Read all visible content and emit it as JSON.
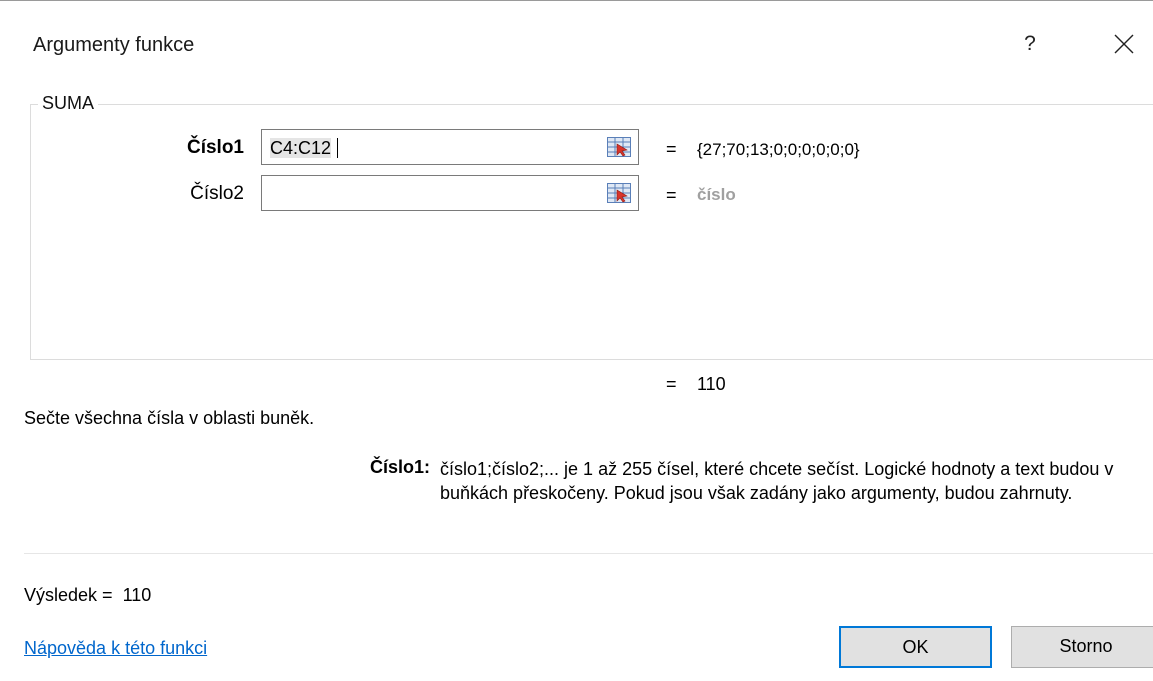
{
  "dialog": {
    "title": "Argumenty funkce",
    "help_glyph": "?",
    "close_glyph": "×"
  },
  "function": {
    "name": "SUMA",
    "args": [
      {
        "label": "Číslo1",
        "value_selected": "C4:C12",
        "result": "{27;70;13;0;0;0;0;0;0}"
      },
      {
        "label": "Číslo2",
        "value": "",
        "result": "číslo"
      }
    ],
    "equals": "=",
    "total": "110"
  },
  "description": {
    "text": "Sečte všechna čísla v oblasti buněk.",
    "arg_label": "Číslo1:",
    "arg_text": "číslo1;číslo2;... je 1 až 255 čísel, které chcete sečíst. Logické hodnoty a text budou v buňkách přeskočeny. Pokud jsou však zadány jako argumenty, budou zahrnuty."
  },
  "footer": {
    "result_label": "Výsledek =",
    "result_value": "110",
    "help_link": "Nápověda k této funkci",
    "ok_label": "OK",
    "cancel_label": "Storno"
  },
  "icons": {
    "ref_icon": "range-selector-icon",
    "close_icon": "close-icon"
  },
  "colors": {
    "accent": "#0078d7",
    "link": "#0066cc"
  }
}
